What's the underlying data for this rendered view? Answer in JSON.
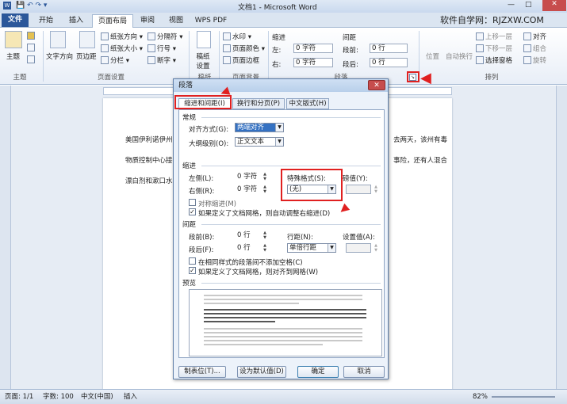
{
  "window": {
    "title": "文档1 - Microsoft Word"
  },
  "watermark": "软件自学网：RJZXW.COM",
  "tabs": [
    "文件",
    "开始",
    "插入",
    "页面布局",
    "审阅",
    "视图",
    "WPS PDF"
  ],
  "ribbon": {
    "theme_label": "主题",
    "text_dir": "文字方向",
    "margins": "页边距",
    "orientation": "纸张方向",
    "size": "纸张大小",
    "columns": "分栏",
    "breaks": "分隔符",
    "line_numbers": "行号",
    "hyphenation": "断字",
    "paper": "稿纸设置",
    "watermark": "水印",
    "page_color": "页面颜色",
    "page_borders": "页面边框",
    "indent_label": "缩进",
    "indent_left": "左:",
    "indent_left_val": "0 字符",
    "indent_right": "右:",
    "indent_right_val": "0 字符",
    "spacing_label": "间距",
    "spacing_before": "段前:",
    "spacing_before_val": "0 行",
    "spacing_after": "段后:",
    "spacing_after_val": "0 行",
    "position": "位置",
    "wrap": "自动换行",
    "forward": "上移一层",
    "backward": "下移一层",
    "selection_pane": "选择窗格",
    "align": "对齐",
    "group": "组合",
    "rotate": "旋转",
    "group_page_setup": "页面设置",
    "group_theme": "主题",
    "group_paper": "稿纸",
    "group_bg": "页面背景",
    "group_para": "段落",
    "group_arrange": "排列"
  },
  "doc": {
    "line1a": "美国伊利诺伊州",
    "line1b": "去两天，该州有毒",
    "line2a": "物质控制中心接",
    "line2b": "事险，还有人混合",
    "line3a": "漂白剂和漱口水"
  },
  "dialog": {
    "title": "段落",
    "close": "✕",
    "tabs": [
      "缩进和间距(I)",
      "换行和分页(P)",
      "中文版式(H)"
    ],
    "general": "常规",
    "align_label": "对齐方式(G):",
    "align_val": "两端对齐",
    "outline_label": "大纲级别(O):",
    "outline_val": "正文文本",
    "indent": "缩进",
    "left_label": "左侧(L):",
    "left_val": "0 字符",
    "right_label": "右侧(R):",
    "right_val": "0 字符",
    "special_label": "特殊格式(S):",
    "special_val": "(无)",
    "by_label": "磅值(Y):",
    "mirror": "对称缩进(M)",
    "auto_adjust": "如果定义了文档网格，则自动调整右缩进(D)",
    "spacing": "间距",
    "before_label": "段前(B):",
    "before_val": "0 行",
    "after_label": "段后(F):",
    "after_val": "0 行",
    "line_label": "行距(N):",
    "line_val": "单倍行距",
    "at_label": "设置值(A):",
    "no_space": "在相同样式的段落间不添加空格(C)",
    "snap_grid": "如果定义了文档网格，则对齐到网格(W)",
    "preview": "预览",
    "btn_tabs": "制表位(T)...",
    "btn_default": "设为默认值(D)",
    "btn_ok": "确定",
    "btn_cancel": "取消"
  },
  "status": {
    "page": "页面: 1/1",
    "words": "字数: 100",
    "lang": "中文(中国)",
    "mode": "插入",
    "zoom": "82%"
  },
  "colors": {
    "accent": "#2b579a",
    "highlight": "#e02020"
  }
}
